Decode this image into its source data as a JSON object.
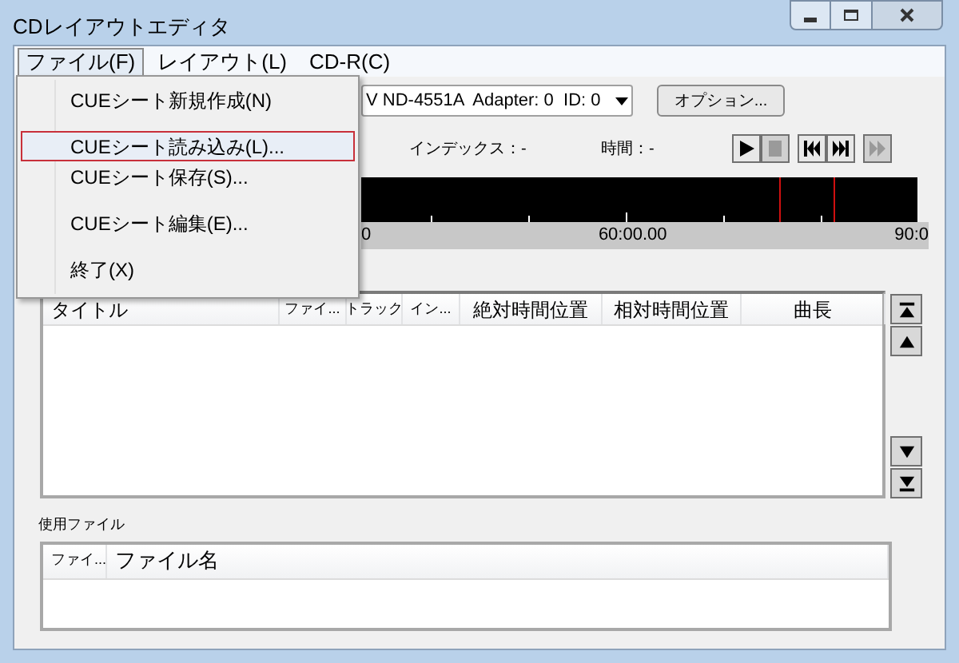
{
  "window": {
    "title": "CDレイアウトエディタ"
  },
  "menu_bar": [
    {
      "label": "ファイル(F)",
      "selected": true
    },
    {
      "label": "レイアウト(L)",
      "selected": false
    },
    {
      "label": "CD-R(C)",
      "selected": false
    }
  ],
  "file_menu": {
    "items": [
      {
        "label": "CUEシート新規作成(N)",
        "selected": false
      },
      {
        "label": "CUEシート読み込み(L)...",
        "selected": true
      },
      {
        "label": "CUEシート保存(S)...",
        "selected": false
      },
      {
        "label": "CUEシート編集(E)...",
        "selected": false
      },
      {
        "label": "終了(X)",
        "selected": false
      }
    ]
  },
  "drive_select": {
    "value": "V ND-4551A  Adapter: 0  ID: 0"
  },
  "options_button": "オプション...",
  "status": {
    "index": "インデックス：-",
    "time": "時間：-"
  },
  "transport": [
    {
      "kind": "play",
      "disabled": false
    },
    {
      "kind": "stop",
      "disabled": true
    },
    {
      "kind": "previous",
      "disabled": false
    },
    {
      "kind": "next",
      "disabled": false
    },
    {
      "kind": "fast_forward",
      "disabled": true
    }
  ],
  "timeline": {
    "labels": [
      "0",
      "60:00.00",
      "90:0"
    ]
  },
  "track_table": {
    "columns": [
      "タイトル",
      "ファイ...",
      "トラック",
      "イン...",
      "絶対時間位置",
      "相対時間位置",
      "曲長"
    ]
  },
  "move_buttons": [
    {
      "kind": "top"
    },
    {
      "kind": "up"
    },
    {
      "kind": "down"
    },
    {
      "kind": "bottom"
    }
  ],
  "files_label": "使用ファイル",
  "file_table": {
    "columns": [
      "ファイ...",
      "ファイル名"
    ]
  }
}
